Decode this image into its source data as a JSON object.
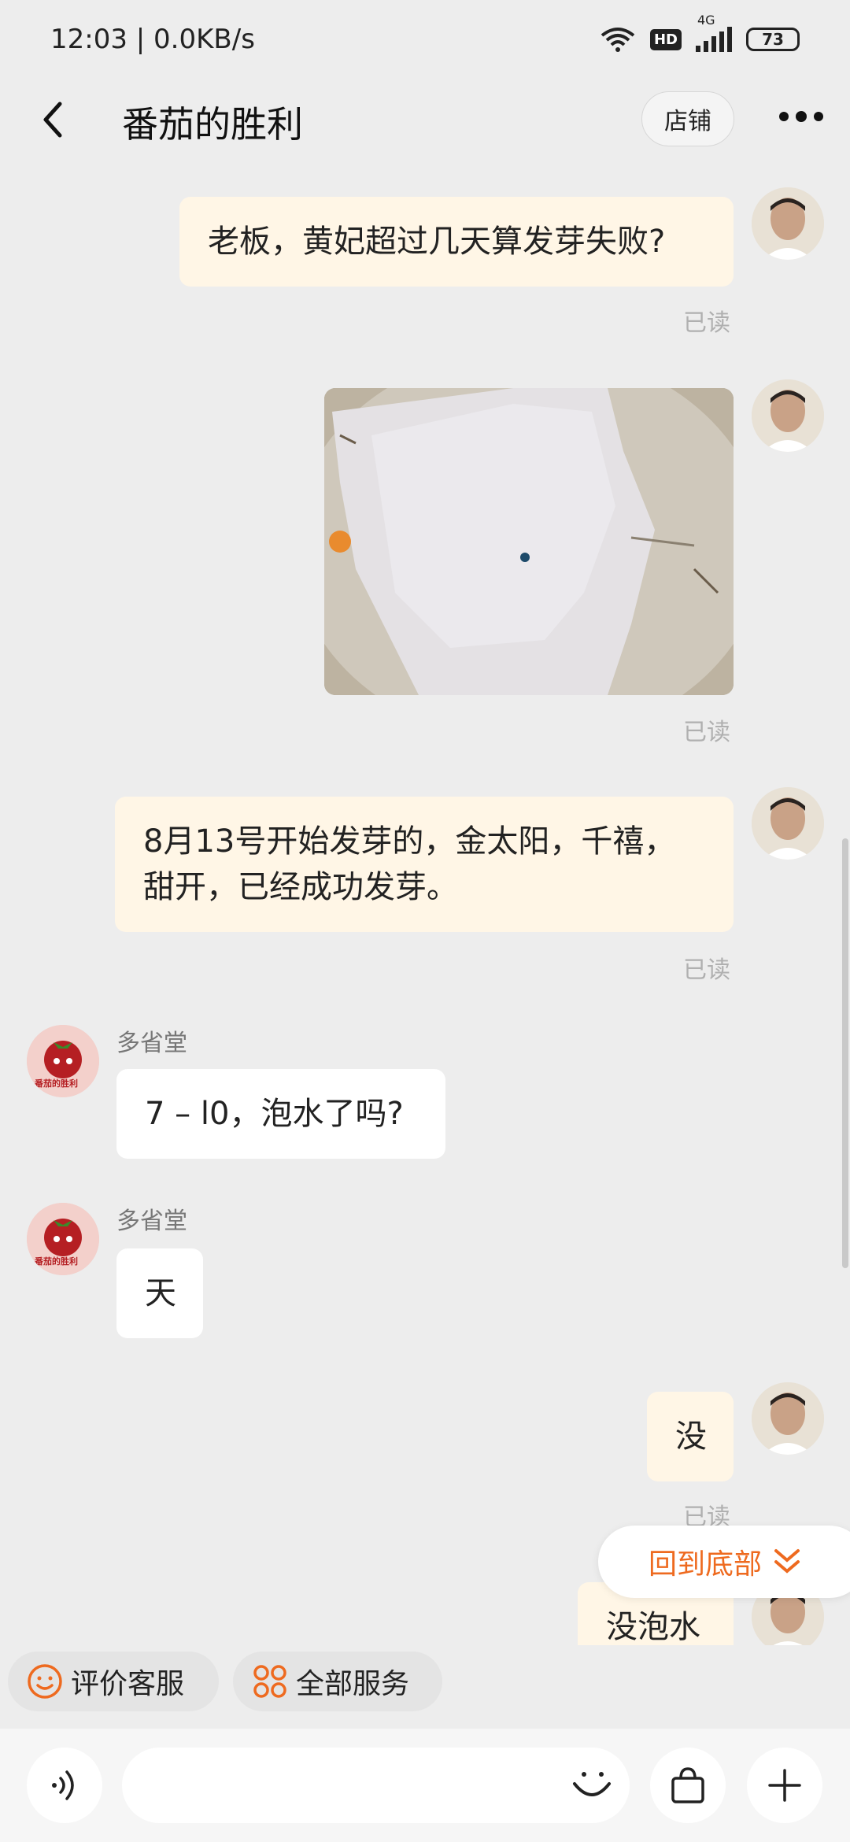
{
  "status_bar": {
    "time_speed": "12:03 | 0.0KB/s",
    "hd": "HD",
    "network": "4G",
    "battery": "73"
  },
  "header": {
    "title": "番茄的胜利",
    "shop_label": "店铺"
  },
  "messages": [
    {
      "from": "me",
      "text": "老板，黄妃超过几天算发芽失败?",
      "status": "已读"
    },
    {
      "from": "me",
      "type": "image",
      "status": "已读"
    },
    {
      "from": "me",
      "text_line1": "8月13号开始发芽的，金太阳，千禧，",
      "text_line2": "甜开，已经成功发芽。",
      "status": "已读"
    },
    {
      "from": "shop",
      "sender": "多省堂",
      "text": "7 – l0，泡水了吗?"
    },
    {
      "from": "shop",
      "sender": "多省堂",
      "text": "天"
    },
    {
      "from": "me",
      "text": "没",
      "status": "已读"
    },
    {
      "from": "me",
      "text": "没泡水"
    }
  ],
  "shop_avatar_text": "番茄的胜利",
  "back_to_bottom": "回到底部",
  "quick_actions": {
    "rate_service": "评价客服",
    "all_services": "全部服务"
  },
  "input": {
    "placeholder": ""
  },
  "colors": {
    "accent": "#ee6a1f",
    "my_bubble": "#fff6e6",
    "background": "#ededed"
  }
}
